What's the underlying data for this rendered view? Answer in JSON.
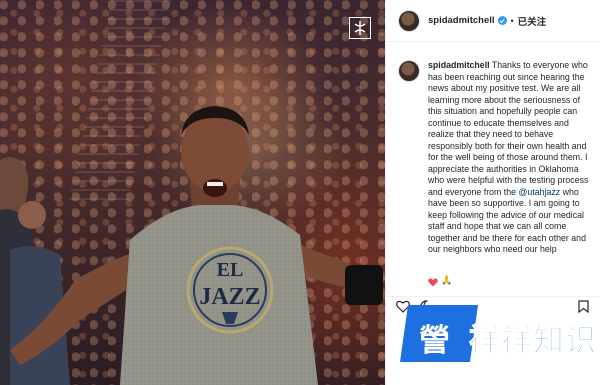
{
  "post": {
    "username": "spidadmitchell",
    "follow_status": "已关注",
    "separator": "•",
    "caption_user": "spidadmitchell",
    "caption_part1": "Thanks to everyone who has been reaching out since hearing the news about my positive test. We are all learning more about the seriousness of this situation and hopefully people can continue to educate themselves and realize that they need to behave responsibly both for their own health and for the well being of those around them. I appreciate the authorities in Oklahoma who were helpful with the testing process and everyone from the ",
    "mention": "@utahjazz",
    "caption_part2": " who have been so supportive. I am going to keep following the advice of our medical staff and hope that we can all come together and be there for each other and our neighbors who need our help",
    "emojis": "🙏"
  },
  "photo": {
    "jersey_line1": "EL",
    "jersey_line2": "JAZZ",
    "logo_icon": "nba-logo-icon"
  },
  "icons": [
    "verified-badge-icon",
    "heart-icon",
    "like-icon",
    "comment-icon",
    "bookmark-icon",
    "nba-logo-icon"
  ],
  "watermark": {
    "first_char": "謍",
    "rest": "祥祥知识"
  },
  "colors": {
    "accent_blue": "#3897f0",
    "mention_blue": "#003569",
    "heart_red": "#ed4956",
    "watermark_blue": "#1e6fe0"
  }
}
